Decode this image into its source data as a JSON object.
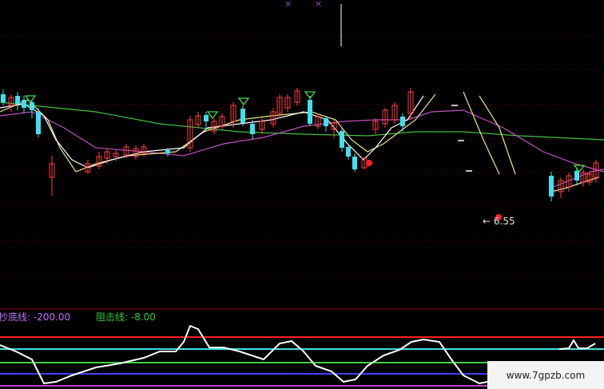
{
  "indicator": {
    "bottom_line_label": "抄底线:",
    "bottom_line_value": "-200.00",
    "block_line_label": "阻击线:",
    "block_line_value": "-8.00"
  },
  "price_annotation": {
    "arrow": "←",
    "value": "6.55"
  },
  "top_markers": [
    "×",
    "×"
  ],
  "watermark": "www.7gpzb.com",
  "colors": {
    "background": "#000000",
    "up_candle": "#ff4040",
    "down_candle": "#40e0f0",
    "ma_short": "#ffffff",
    "ma_mid": "#f0e68c",
    "ma_long": "#c050c0",
    "ma_longest": "#40c040",
    "grid": "#7a0000",
    "oscillator": "#ffffff",
    "level_red": "#ff2020",
    "level_cyan": "#40e0e0",
    "level_green": "#40d040",
    "level_blue": "#4040ff",
    "level_magenta": "#c040c0"
  }
}
